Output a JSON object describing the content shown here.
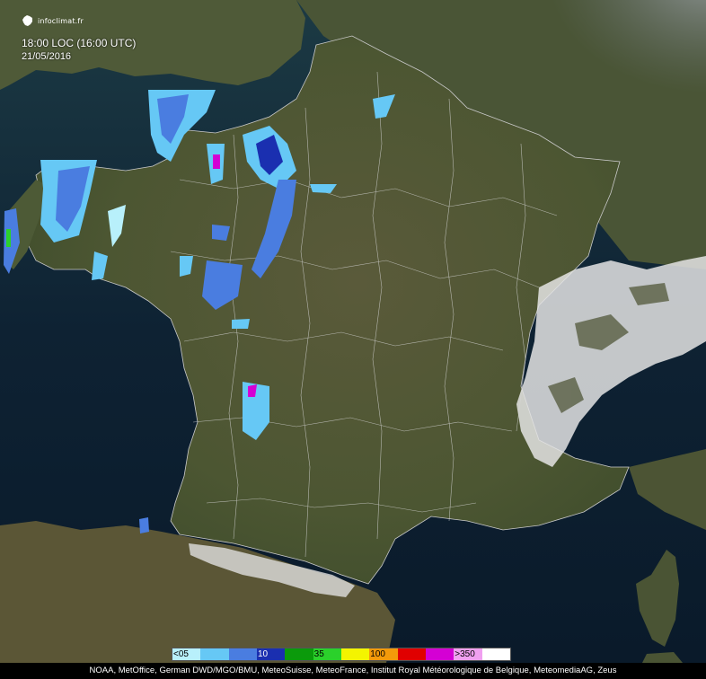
{
  "header": {
    "brand": "infoclimat.fr",
    "time": "18:00 LOC (16:00 UTC)",
    "date": "21/05/2016"
  },
  "legend": {
    "items": [
      {
        "label": "<05",
        "color": "#b8f0fb"
      },
      {
        "label": "",
        "color": "#66c8f5"
      },
      {
        "label": "",
        "color": "#4a7de0"
      },
      {
        "label": "10",
        "color": "#1a2fb0"
      },
      {
        "label": "",
        "color": "#0b9a0b"
      },
      {
        "label": "35",
        "color": "#2bd12b"
      },
      {
        "label": "",
        "color": "#f4f400"
      },
      {
        "label": "100",
        "color": "#f49a0a"
      },
      {
        "label": "",
        "color": "#e00000"
      },
      {
        "label": "",
        "color": "#d400d4"
      },
      {
        "label": ">350",
        "color": "#f0a0f0"
      },
      {
        "label": "",
        "color": "#ffffff"
      }
    ]
  },
  "credits": "NOAA, MetOffice, German DWD/MGO/BMU, MeteoSuisse, MeteoFrance, Institut Royal Météorologique de Belgique, MeteomediaAG, Zeus",
  "colors": {
    "sea": "#0e2233",
    "land": "#4e5a36",
    "border": "#d8d8d8",
    "snow": "#e6e6e6"
  }
}
